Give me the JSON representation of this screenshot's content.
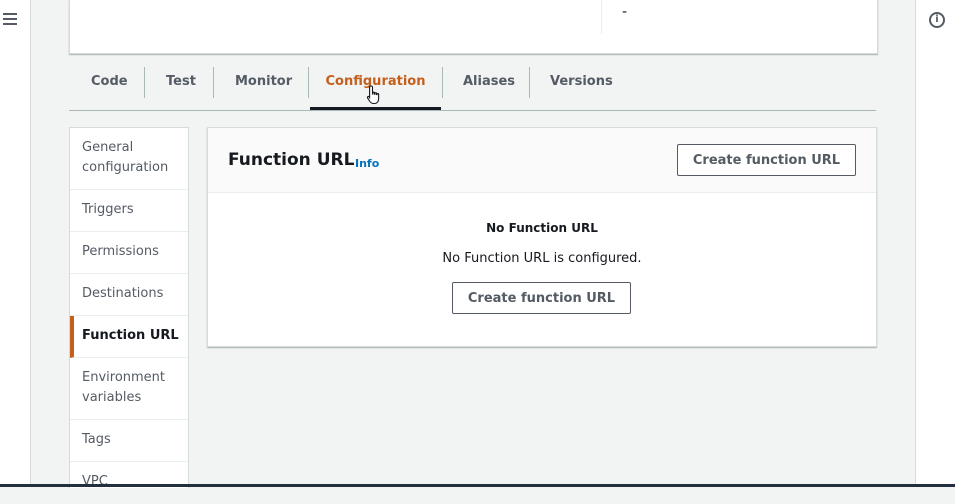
{
  "header": {
    "value_dash": "-"
  },
  "tabs": [
    {
      "label": "Code"
    },
    {
      "label": "Test"
    },
    {
      "label": "Monitor"
    },
    {
      "label": "Configuration",
      "active": true
    },
    {
      "label": "Aliases"
    },
    {
      "label": "Versions"
    }
  ],
  "sidebar": {
    "items": [
      {
        "label": "General configuration"
      },
      {
        "label": "Triggers"
      },
      {
        "label": "Permissions"
      },
      {
        "label": "Destinations"
      },
      {
        "label": "Function URL",
        "active": true
      },
      {
        "label": "Environment variables"
      },
      {
        "label": "Tags"
      },
      {
        "label": "VPC"
      }
    ]
  },
  "panel": {
    "title": "Function URL",
    "info_link": "Info",
    "header_button": "Create function URL",
    "empty_title": "No Function URL",
    "empty_description": "No Function URL is configured.",
    "empty_button": "Create function URL"
  },
  "colors": {
    "accent": "#c45f1c",
    "link": "#0073bb",
    "text": "#16191f",
    "muted": "#545b64"
  },
  "icons": {
    "menu": "hamburger-icon",
    "help": "info-icon",
    "cursor": "hand-pointer-icon"
  }
}
